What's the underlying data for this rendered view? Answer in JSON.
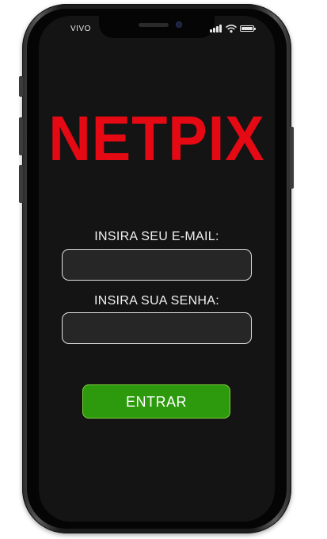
{
  "status_bar": {
    "carrier": "VIVO",
    "signal_icon": "signal-bars-icon",
    "wifi_icon": "wifi-icon",
    "battery_icon": "battery-icon",
    "battery_level": 1.0
  },
  "logo": {
    "text": "NETPIX",
    "color": "#e50914"
  },
  "login_form": {
    "email_label": "INSIRA SEU E-MAIL:",
    "email_value": "",
    "password_label": "INSIRA SUA SENHA:",
    "password_value": "",
    "submit_label": "ENTRAR"
  },
  "colors": {
    "background": "#141414",
    "input_background": "#262626",
    "button": "#2d9a0e",
    "button_border": "#7fd23a"
  }
}
